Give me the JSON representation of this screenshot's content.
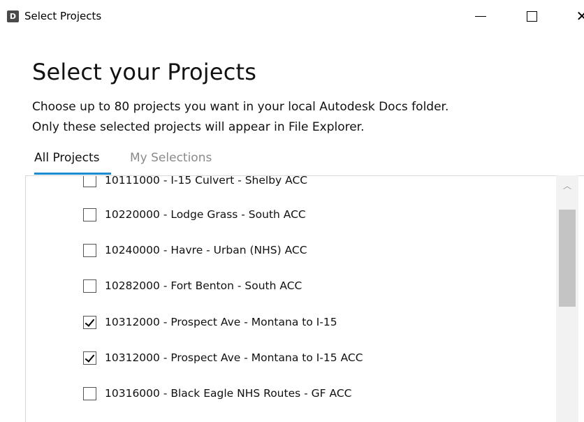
{
  "window": {
    "app_icon_letter": "D",
    "title": "Select Projects",
    "minimize_glyph": "",
    "close_glyph": "✕"
  },
  "header": {
    "title": "Select your Projects",
    "description_line1": "Choose up to 80 projects you want in your local Autodesk Docs folder.",
    "description_line2": "Only these selected projects will appear in File Explorer."
  },
  "tabs": [
    {
      "label": "All Projects",
      "active": true
    },
    {
      "label": "My Selections",
      "active": false
    }
  ],
  "projects": [
    {
      "label": "10111000 - I-15 Culvert - Shelby ACC",
      "checked": false
    },
    {
      "label": "10220000 - Lodge Grass - South ACC",
      "checked": false
    },
    {
      "label": "10240000 - Havre - Urban (NHS) ACC",
      "checked": false
    },
    {
      "label": "10282000 - Fort Benton - South ACC",
      "checked": false
    },
    {
      "label": "10312000 - Prospect Ave - Montana to I-15",
      "checked": true
    },
    {
      "label": "10312000 - Prospect Ave - Montana to I-15 ACC",
      "checked": true
    },
    {
      "label": "10316000 - Black Eagle NHS Routes - GF ACC",
      "checked": false
    },
    {
      "label": "",
      "checked": false
    }
  ],
  "scrollbar": {
    "up_arrow_icon": "chevron-up-icon",
    "up_arrow_glyph": "︿"
  },
  "colors": {
    "accent": "#1b8bd2",
    "inactive_tab": "#8a8a8a"
  }
}
